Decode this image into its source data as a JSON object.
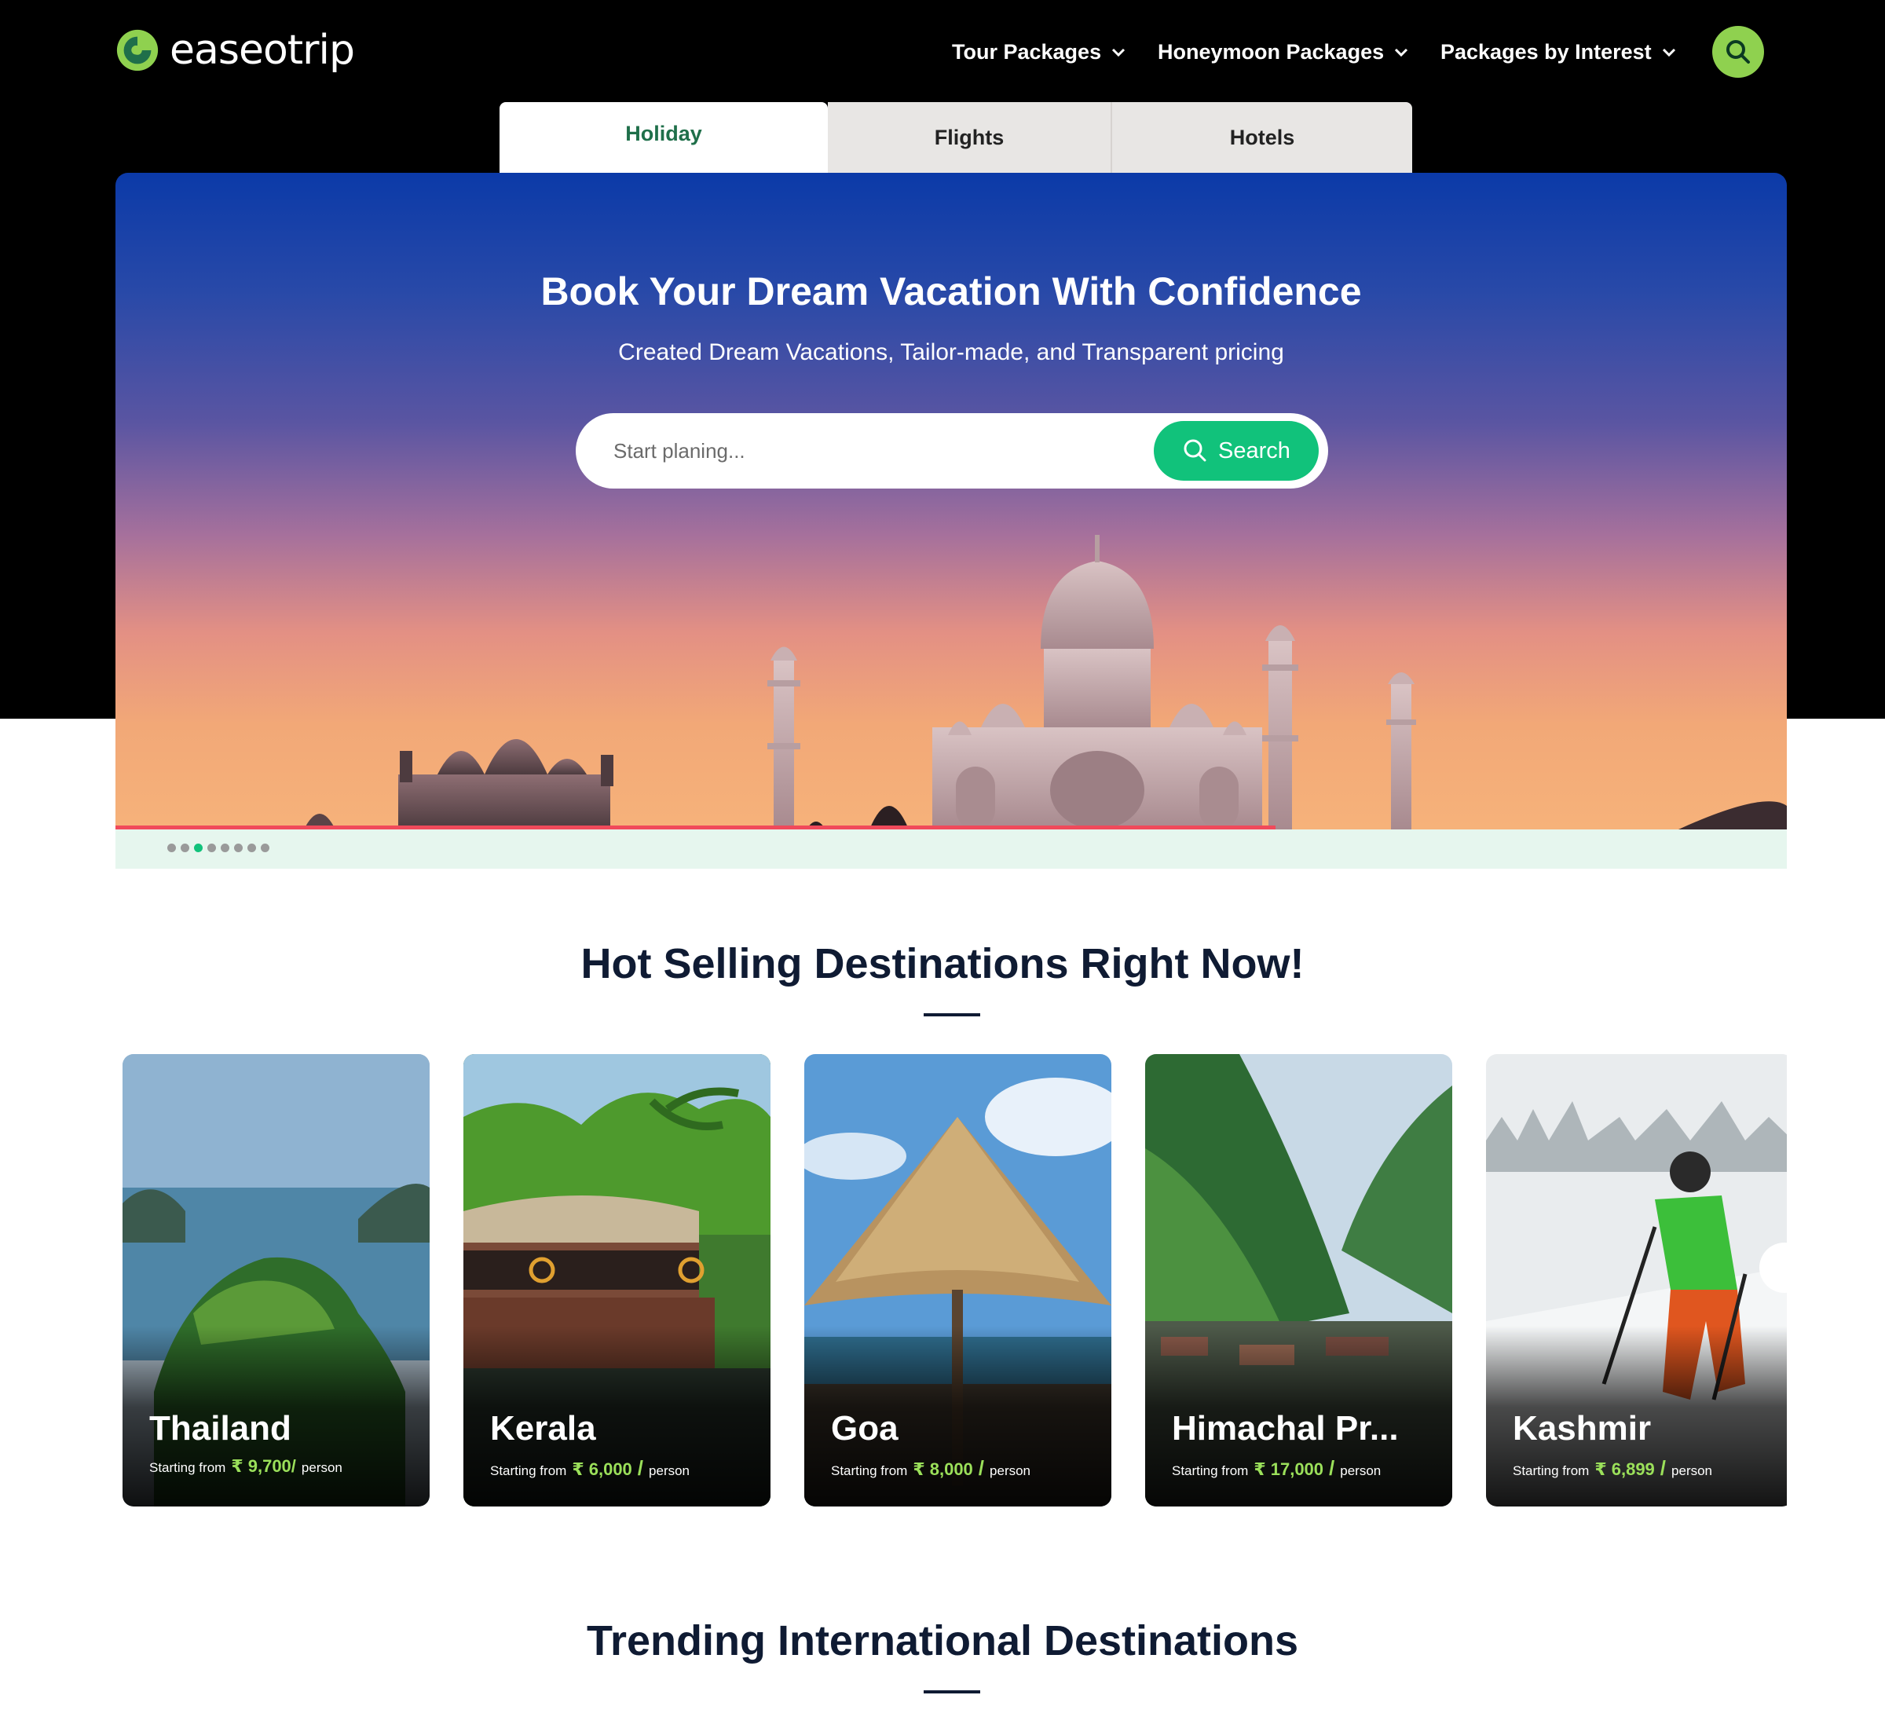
{
  "brand": {
    "name": "easeotrip",
    "accent": "#8fd14f"
  },
  "nav": {
    "items": [
      {
        "label": "Tour Packages"
      },
      {
        "label": "Honeymoon Packages"
      },
      {
        "label": "Packages by Interest"
      }
    ]
  },
  "tabs": [
    {
      "label": "Holiday",
      "active": true
    },
    {
      "label": "Flights",
      "active": false
    },
    {
      "label": "Hotels",
      "active": false
    }
  ],
  "hero": {
    "title": "Book Your Dream Vacation With Confidence",
    "subtitle": "Created Dream Vacations, Tailor-made, and Transparent pricing",
    "search_placeholder": "Start planing...",
    "search_button": "Search",
    "slides_count": 8,
    "active_slide": 3
  },
  "hot_selling": {
    "title": "Hot Selling Destinations Right Now!",
    "cards": [
      {
        "name": "Thailand",
        "from_label": "Starting from",
        "price": "₹ 9,700/",
        "per": "person"
      },
      {
        "name": "Kerala",
        "from_label": "Starting from",
        "price": "₹ 6,000",
        "slash": "/",
        "per": "person"
      },
      {
        "name": "Goa",
        "from_label": "Starting from",
        "price": "₹ 8,000",
        "slash": "/",
        "per": "person"
      },
      {
        "name": "Himachal Pr...",
        "from_label": "Starting from",
        "price": "₹ 17,000",
        "slash": "/",
        "per": "person"
      },
      {
        "name": "Kashmir",
        "from_label": "Starting from",
        "price": "₹ 6,899",
        "slash": "/",
        "per": "person"
      }
    ]
  },
  "trending": {
    "title": "Trending International Destinations"
  }
}
